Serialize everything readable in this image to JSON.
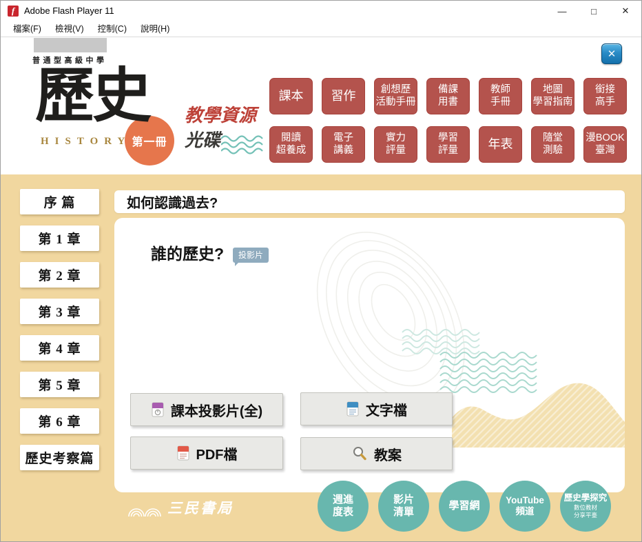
{
  "window": {
    "title": "Adobe Flash Player 11",
    "icon_letter": "f",
    "menu": [
      "檔案(F)",
      "檢視(V)",
      "控制(C)",
      "說明(H)"
    ],
    "controls": {
      "minimize": "—",
      "maximize": "□",
      "close": "✕"
    }
  },
  "header": {
    "school_type": "普通型高級中學",
    "subject": "歷史",
    "subject_en": "HISTORY",
    "volume": "第一冊",
    "resource_line1": "教學資源",
    "resource_line2": "光碟",
    "close": "✕"
  },
  "nav": {
    "items": [
      "課本",
      "習作",
      "創想歷\n活動手冊",
      "備課\n用書",
      "教師\n手冊",
      "地圖\n學習指南",
      "銜接\n高手",
      "閱讀\n超養成",
      "電子\n講義",
      "實力\n評量",
      "學習\n評量",
      "年表",
      "隨堂\n測驗",
      "漫BOOK\n臺灣"
    ]
  },
  "sidebar": {
    "items": [
      "序 篇",
      "第 1 章",
      "第 2 章",
      "第 3 章",
      "第 4 章",
      "第 5 章",
      "第 6 章",
      "歷史考察篇"
    ]
  },
  "content": {
    "heading": "如何認識過去?",
    "topic": "誰的歷史?",
    "topic_tag": "投影片",
    "files": [
      {
        "label": "課本投影片(全)",
        "icon": "ppt-file-icon"
      },
      {
        "label": "文字檔",
        "icon": "doc-file-icon"
      },
      {
        "label": "PDF檔",
        "icon": "pdf-file-icon"
      },
      {
        "label": "教案",
        "icon": "magnifier-icon"
      }
    ]
  },
  "footer": {
    "circles": [
      {
        "label": "週進\n度表"
      },
      {
        "label": "影片\n清單"
      },
      {
        "label": "學習網"
      },
      {
        "label": "YouTube\n頻道"
      },
      {
        "label": "歷史學探究",
        "sub": "數位教材\n分享平臺"
      }
    ],
    "publisher": "三民書局"
  },
  "colors": {
    "tan": "#f1d79f",
    "brick": "#b4534d",
    "brick_border": "#a6423c",
    "teal": "#68b7ae",
    "orange": "#e6764c",
    "gold": "#a8863e",
    "tag_blue": "#8fabbe",
    "flash_red": "#c9252d",
    "close_blue": "#1470ab"
  }
}
